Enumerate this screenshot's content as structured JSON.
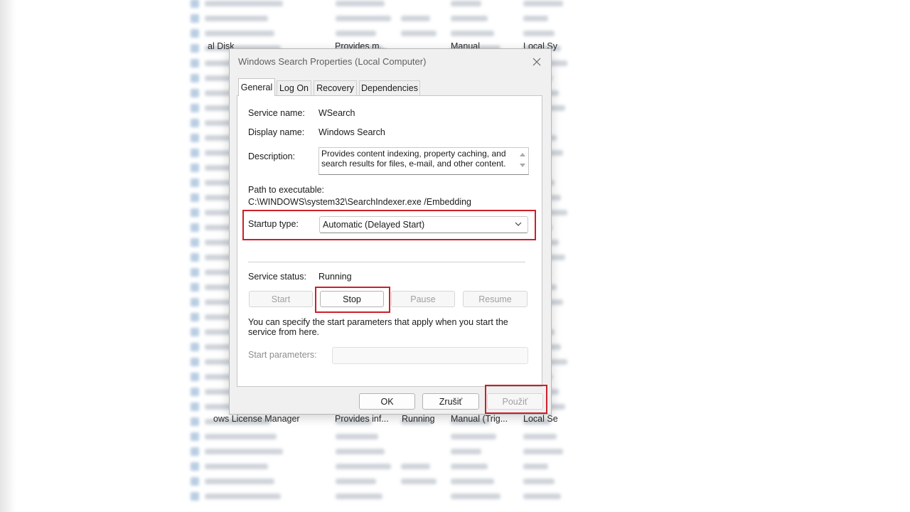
{
  "background": {
    "visible_rows_top": [
      {
        "name": "al Disk",
        "description": "Provides m...",
        "startup": "Manual",
        "logon": "Local Sy"
      }
    ],
    "visible_rows_bottom": [
      {
        "name": "ows License Manager",
        "description": "Provides inf...",
        "status": "Running",
        "startup": "Manual (Trig...",
        "logon": "Local Se"
      }
    ]
  },
  "dialog": {
    "title": "Windows Search Properties (Local Computer)",
    "close_glyph": "✕",
    "tabs": [
      {
        "label": "General",
        "active": true
      },
      {
        "label": "Log On",
        "active": false
      },
      {
        "label": "Recovery",
        "active": false
      },
      {
        "label": "Dependencies",
        "active": false
      }
    ],
    "general": {
      "service_name_label": "Service name:",
      "service_name_value": "WSearch",
      "display_name_label": "Display name:",
      "display_name_value": "Windows Search",
      "description_label": "Description:",
      "description_value": "Provides content indexing, property caching, and search results for files, e-mail, and other content.",
      "path_label": "Path to executable:",
      "path_value": "C:\\WINDOWS\\system32\\SearchIndexer.exe /Embedding",
      "startup_type_label": "Startup type:",
      "startup_type_value": "Automatic (Delayed Start)",
      "service_status_label": "Service status:",
      "service_status_value": "Running",
      "start_button": "Start",
      "stop_button": "Stop",
      "pause_button": "Pause",
      "resume_button": "Resume",
      "hint_text": "You can specify the start parameters that apply when you start the service from here.",
      "start_parameters_label": "Start parameters:",
      "start_parameters_value": ""
    },
    "footer": {
      "ok_button": "OK",
      "cancel_button": "Zrušiť",
      "apply_button": "Použiť"
    }
  },
  "highlight_color": "#cc1f2a",
  "icons": {
    "close": "close-icon",
    "dropdown": "chevron-down-icon",
    "scroll_up": "scroll-up-icon",
    "scroll_down": "scroll-down-icon",
    "service": "service-gear-icon"
  }
}
